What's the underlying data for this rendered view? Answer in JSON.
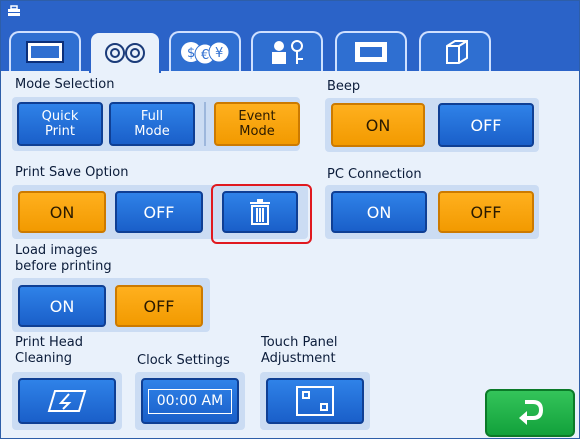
{
  "tabs": [
    {
      "icon": "image-frame-icon",
      "active": false
    },
    {
      "icon": "gears-icon",
      "active": true
    },
    {
      "icon": "currency-icon",
      "active": false
    },
    {
      "icon": "user-key-icon",
      "active": false
    },
    {
      "icon": "frame-icon",
      "active": false
    },
    {
      "icon": "box-icon",
      "active": false
    }
  ],
  "mode_selection": {
    "label": "Mode Selection",
    "quick_print": "Quick\nPrint",
    "full_mode": "Full\nMode",
    "event_mode": "Event\nMode",
    "selected": "Event Mode"
  },
  "beep": {
    "label": "Beep",
    "on": "ON",
    "off": "OFF",
    "selected": "ON"
  },
  "print_save": {
    "label": "Print Save Option",
    "on": "ON",
    "off": "OFF",
    "selected": "ON",
    "delete_icon": "trash-icon"
  },
  "pc_connection": {
    "label": "PC Connection",
    "on": "ON",
    "off": "OFF",
    "selected": "OFF"
  },
  "load_images": {
    "label": "Load images\nbefore printing",
    "on": "ON",
    "off": "OFF",
    "selected": "OFF"
  },
  "print_head": {
    "label": "Print Head\nCleaning",
    "icon": "cleaning-icon"
  },
  "clock": {
    "label": "Clock Settings",
    "value": "00:00 AM"
  },
  "touch_panel": {
    "label": "Touch Panel\nAdjustment",
    "icon": "calibration-icon"
  },
  "back_button": {
    "icon": "return-arrow-icon"
  },
  "colors": {
    "blue": "#2b63c8",
    "orange": "#f7a30c",
    "green": "#1ab04a",
    "highlight": "#e0191f"
  }
}
